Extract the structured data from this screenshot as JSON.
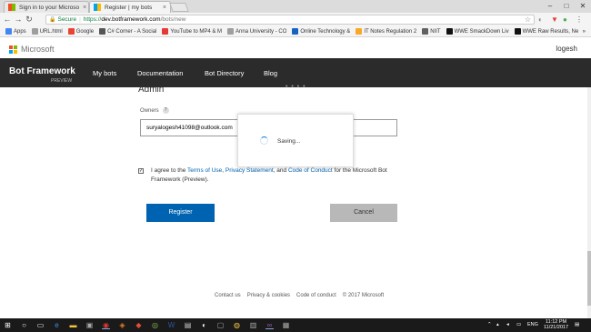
{
  "browser": {
    "tabs": [
      {
        "title": "Sign in to your Microso",
        "active": false
      },
      {
        "title": "Register | my bots",
        "active": true
      }
    ],
    "address": {
      "secure_label": "Secure",
      "url_proto": "https://",
      "url_host": "dev.botframework.com",
      "url_path": "/bots/new"
    },
    "bookmarks": [
      {
        "label": "Apps",
        "color": "#4285f4"
      },
      {
        "label": "URL.html",
        "color": "#9e9e9e"
      },
      {
        "label": "Google",
        "color": "#ea4335"
      },
      {
        "label": "C# Corner - A Social",
        "color": "#555555"
      },
      {
        "label": "YouTube to MP4 & M",
        "color": "#e53935"
      },
      {
        "label": "Anna University - CO",
        "color": "#9e9e9e"
      },
      {
        "label": "Online Technology &",
        "color": "#1565c0"
      },
      {
        "label": "IT Notes Regulation 2",
        "color": "#f9a825"
      },
      {
        "label": "NIIT",
        "color": "#616161"
      },
      {
        "label": "WWE SmackDown Liv",
        "color": "#111111"
      },
      {
        "label": "WWE Raw Results, Ne",
        "color": "#111111"
      }
    ],
    "more_label": "»"
  },
  "msbar": {
    "brand": "Microsoft",
    "user": "logesh"
  },
  "nav": {
    "brand": "Bot Framework",
    "brand_sub": "PREVIEW",
    "links": [
      "My bots",
      "Documentation",
      "Bot Directory",
      "Blog"
    ]
  },
  "form": {
    "section_heading": "Admin",
    "owners_label": "Owners",
    "owners_value": "suryalogesh41098@outlook.com",
    "agree_prefix": "I agree to the ",
    "terms_link": "Terms of Use",
    "comma": ", ",
    "privacy_link": "Privacy Statement",
    "and": ", and ",
    "conduct_link": "Code of Conduct",
    "agree_suffix": " for the Microsoft Bot Framework (Preview).",
    "agreed": true,
    "register_label": "Register",
    "cancel_label": "Cancel"
  },
  "dialog": {
    "message": "Saving..."
  },
  "footer": {
    "links": [
      "Contact us",
      "Privacy & cookies",
      "Code of conduct"
    ],
    "copyright": "© 2017 Microsoft"
  },
  "taskbar": {
    "language": "ENG",
    "time": "11:12 PM",
    "date": "11/21/2017"
  },
  "colors": {
    "nav_bg": "#2b2b2b",
    "accent": "#0063b1",
    "cancel_bg": "#b8b8b8"
  }
}
